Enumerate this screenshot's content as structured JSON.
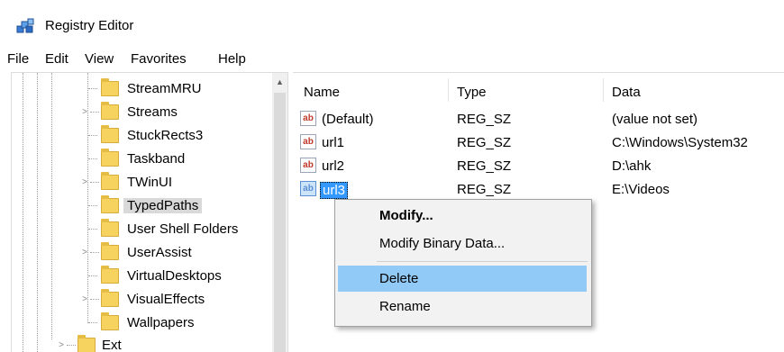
{
  "window": {
    "title": "Registry Editor"
  },
  "menu": [
    "File",
    "Edit",
    "View",
    "Favorites",
    "Help"
  ],
  "tree": {
    "items": [
      {
        "label": "StreamMRU",
        "expander": "",
        "selected": false
      },
      {
        "label": "Streams",
        "expander": ">",
        "selected": false
      },
      {
        "label": "StuckRects3",
        "expander": "",
        "selected": false
      },
      {
        "label": "Taskband",
        "expander": "",
        "selected": false
      },
      {
        "label": "TWinUI",
        "expander": ">",
        "selected": false
      },
      {
        "label": "TypedPaths",
        "expander": "",
        "selected": true
      },
      {
        "label": "User Shell Folders",
        "expander": "",
        "selected": false
      },
      {
        "label": "UserAssist",
        "expander": ">",
        "selected": false
      },
      {
        "label": "VirtualDesktops",
        "expander": "",
        "selected": false
      },
      {
        "label": "VisualEffects",
        "expander": ">",
        "selected": false
      },
      {
        "label": "Wallpapers",
        "expander": "",
        "selected": false
      },
      {
        "label": "Ext",
        "expander": ">",
        "selected": false
      }
    ]
  },
  "list": {
    "columns": {
      "name": "Name",
      "type": "Type",
      "data": "Data"
    },
    "icon_text": "ab",
    "rows": [
      {
        "name": "(Default)",
        "type": "REG_SZ",
        "data": "(value not set)"
      },
      {
        "name": "url1",
        "type": "REG_SZ",
        "data": "C:\\Windows\\System32"
      },
      {
        "name": "url2",
        "type": "REG_SZ",
        "data": "D:\\ahk"
      },
      {
        "name": "url3",
        "type": "REG_SZ",
        "data": "E:\\Videos"
      }
    ]
  },
  "context_menu": {
    "items": [
      "Modify...",
      "Modify Binary Data...",
      "Delete",
      "Rename"
    ]
  },
  "scrollbar": {
    "up_arrow": "▲"
  }
}
